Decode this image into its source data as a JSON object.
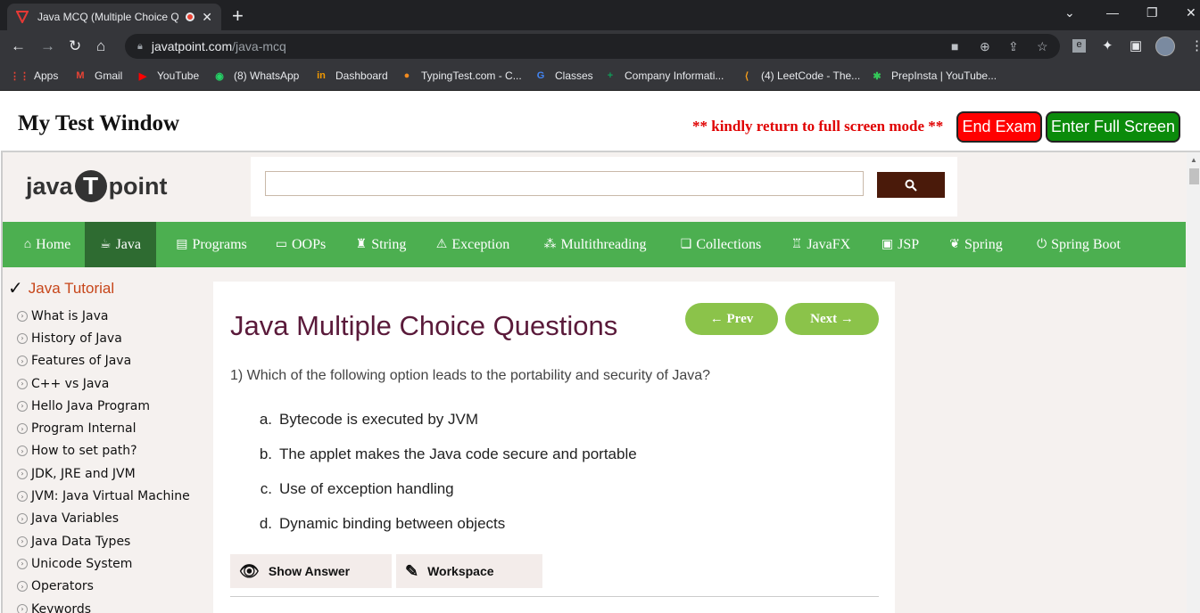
{
  "browser": {
    "tab_title": "Java MCQ (Multiple Choice Q",
    "url_host": "javatpoint.com",
    "url_path": "/java-mcq",
    "bookmarks": [
      {
        "label": "Apps",
        "icon": "apps-grid-icon",
        "color": "#ea4335"
      },
      {
        "label": "Gmail",
        "icon": "gmail-icon",
        "color": "#ea4335"
      },
      {
        "label": "YouTube",
        "icon": "youtube-icon",
        "color": "#ff0000"
      },
      {
        "label": "(8) WhatsApp",
        "icon": "whatsapp-icon",
        "color": "#25d366"
      },
      {
        "label": "Dashboard",
        "icon": "dashboard-icon",
        "color": "#f29900"
      },
      {
        "label": "TypingTest.com - C...",
        "icon": "typingtest-icon",
        "color": "#f28b1e"
      },
      {
        "label": "Classes",
        "icon": "google-icon",
        "color": "#4285f4"
      },
      {
        "label": "Company Informati...",
        "icon": "sheets-icon",
        "color": "#0f9d58"
      },
      {
        "label": "(4) LeetCode - The...",
        "icon": "leetcode-icon",
        "color": "#f89f1b"
      },
      {
        "label": "PrepInsta | YouTube...",
        "icon": "prepinsta-icon",
        "color": "#34c759"
      }
    ]
  },
  "test": {
    "title": "My Test Window",
    "warning": "** kindly return to full screen mode **",
    "end_exam": "End Exam",
    "full_screen": "Enter Full Screen"
  },
  "site": {
    "logo_left": "java",
    "logo_mid": "T",
    "logo_right": "point",
    "search_placeholder": "",
    "nav": [
      {
        "label": "Home",
        "icon": "home-icon"
      },
      {
        "label": "Java",
        "icon": "java-cup-icon"
      },
      {
        "label": "Programs",
        "icon": "programs-icon"
      },
      {
        "label": "OOPs",
        "icon": "oops-icon"
      },
      {
        "label": "String",
        "icon": "string-icon"
      },
      {
        "label": "Exception",
        "icon": "warning-icon"
      },
      {
        "label": "Multithreading",
        "icon": "multithreading-icon"
      },
      {
        "label": "Collections",
        "icon": "collections-icon"
      },
      {
        "label": "JavaFX",
        "icon": "javafx-icon"
      },
      {
        "label": "JSP",
        "icon": "jsp-icon"
      },
      {
        "label": "Spring",
        "icon": "spring-icon"
      },
      {
        "label": "Spring Boot",
        "icon": "power-icon"
      }
    ],
    "active_nav": "Java"
  },
  "sidebar": {
    "heading": "Java Tutorial",
    "items": [
      "What is Java",
      "History of Java",
      "Features of Java",
      "C++ vs Java",
      "Hello Java Program",
      "Program Internal",
      "How to set path?",
      "JDK, JRE and JVM",
      "JVM: Java Virtual Machine",
      "Java Variables",
      "Java Data Types",
      "Unicode System",
      "Operators",
      "Keywords"
    ]
  },
  "main": {
    "heading": "Java Multiple Choice Questions",
    "prev": "← Prev",
    "next": "Next →",
    "question": "1) Which of the following option leads to the portability and security of Java?",
    "options": [
      {
        "letter": "a.",
        "text": "Bytecode is executed by JVM"
      },
      {
        "letter": "b.",
        "text": "The applet makes the Java code secure and portable"
      },
      {
        "letter": "c.",
        "text": "Use of exception handling"
      },
      {
        "letter": "d.",
        "text": "Dynamic binding between objects"
      }
    ],
    "show_answer": "Show Answer",
    "workspace": "Workspace"
  }
}
